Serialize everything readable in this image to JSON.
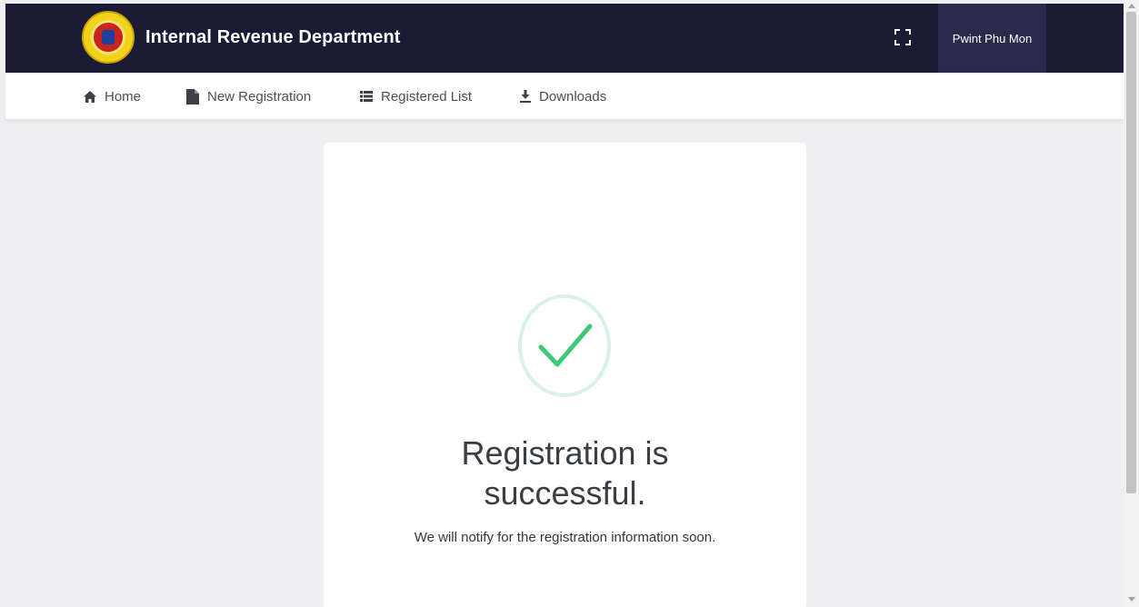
{
  "header": {
    "brand_title": "Internal Revenue Department",
    "user_name": "Pwint Phu Mon",
    "logo_icon": "department-seal-icon",
    "fullscreen_icon": "fullscreen-icon"
  },
  "nav": {
    "items": [
      {
        "label": "Home",
        "icon": "home-icon"
      },
      {
        "label": "New Registration",
        "icon": "document-icon"
      },
      {
        "label": "Registered List",
        "icon": "list-icon"
      },
      {
        "label": "Downloads",
        "icon": "download-icon"
      }
    ]
  },
  "main": {
    "status_icon": "checkmark-circle-icon",
    "title": "Registration is successful.",
    "message": "We will notify for the registration information soon."
  },
  "colors": {
    "header_bg": "#1b1b36",
    "user_bg": "#2a2a4c",
    "page_bg": "#efeff1",
    "success": "#3ec97a"
  }
}
